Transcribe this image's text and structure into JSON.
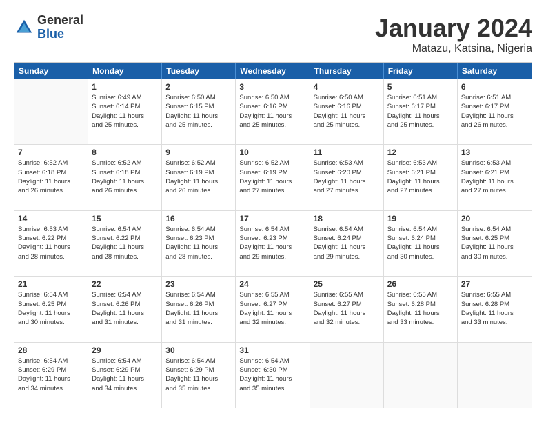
{
  "logo": {
    "general": "General",
    "blue": "Blue"
  },
  "title": "January 2024",
  "location": "Matazu, Katsina, Nigeria",
  "days": [
    "Sunday",
    "Monday",
    "Tuesday",
    "Wednesday",
    "Thursday",
    "Friday",
    "Saturday"
  ],
  "rows": [
    [
      {
        "day": "",
        "empty": true
      },
      {
        "day": "1",
        "sunrise": "Sunrise: 6:49 AM",
        "sunset": "Sunset: 6:14 PM",
        "daylight": "Daylight: 11 hours",
        "minutes": "and 25 minutes."
      },
      {
        "day": "2",
        "sunrise": "Sunrise: 6:50 AM",
        "sunset": "Sunset: 6:15 PM",
        "daylight": "Daylight: 11 hours",
        "minutes": "and 25 minutes."
      },
      {
        "day": "3",
        "sunrise": "Sunrise: 6:50 AM",
        "sunset": "Sunset: 6:16 PM",
        "daylight": "Daylight: 11 hours",
        "minutes": "and 25 minutes."
      },
      {
        "day": "4",
        "sunrise": "Sunrise: 6:50 AM",
        "sunset": "Sunset: 6:16 PM",
        "daylight": "Daylight: 11 hours",
        "minutes": "and 25 minutes."
      },
      {
        "day": "5",
        "sunrise": "Sunrise: 6:51 AM",
        "sunset": "Sunset: 6:17 PM",
        "daylight": "Daylight: 11 hours",
        "minutes": "and 25 minutes."
      },
      {
        "day": "6",
        "sunrise": "Sunrise: 6:51 AM",
        "sunset": "Sunset: 6:17 PM",
        "daylight": "Daylight: 11 hours",
        "minutes": "and 26 minutes."
      }
    ],
    [
      {
        "day": "7",
        "sunrise": "Sunrise: 6:52 AM",
        "sunset": "Sunset: 6:18 PM",
        "daylight": "Daylight: 11 hours",
        "minutes": "and 26 minutes."
      },
      {
        "day": "8",
        "sunrise": "Sunrise: 6:52 AM",
        "sunset": "Sunset: 6:18 PM",
        "daylight": "Daylight: 11 hours",
        "minutes": "and 26 minutes."
      },
      {
        "day": "9",
        "sunrise": "Sunrise: 6:52 AM",
        "sunset": "Sunset: 6:19 PM",
        "daylight": "Daylight: 11 hours",
        "minutes": "and 26 minutes."
      },
      {
        "day": "10",
        "sunrise": "Sunrise: 6:52 AM",
        "sunset": "Sunset: 6:19 PM",
        "daylight": "Daylight: 11 hours",
        "minutes": "and 27 minutes."
      },
      {
        "day": "11",
        "sunrise": "Sunrise: 6:53 AM",
        "sunset": "Sunset: 6:20 PM",
        "daylight": "Daylight: 11 hours",
        "minutes": "and 27 minutes."
      },
      {
        "day": "12",
        "sunrise": "Sunrise: 6:53 AM",
        "sunset": "Sunset: 6:21 PM",
        "daylight": "Daylight: 11 hours",
        "minutes": "and 27 minutes."
      },
      {
        "day": "13",
        "sunrise": "Sunrise: 6:53 AM",
        "sunset": "Sunset: 6:21 PM",
        "daylight": "Daylight: 11 hours",
        "minutes": "and 27 minutes."
      }
    ],
    [
      {
        "day": "14",
        "sunrise": "Sunrise: 6:53 AM",
        "sunset": "Sunset: 6:22 PM",
        "daylight": "Daylight: 11 hours",
        "minutes": "and 28 minutes."
      },
      {
        "day": "15",
        "sunrise": "Sunrise: 6:54 AM",
        "sunset": "Sunset: 6:22 PM",
        "daylight": "Daylight: 11 hours",
        "minutes": "and 28 minutes."
      },
      {
        "day": "16",
        "sunrise": "Sunrise: 6:54 AM",
        "sunset": "Sunset: 6:23 PM",
        "daylight": "Daylight: 11 hours",
        "minutes": "and 28 minutes."
      },
      {
        "day": "17",
        "sunrise": "Sunrise: 6:54 AM",
        "sunset": "Sunset: 6:23 PM",
        "daylight": "Daylight: 11 hours",
        "minutes": "and 29 minutes."
      },
      {
        "day": "18",
        "sunrise": "Sunrise: 6:54 AM",
        "sunset": "Sunset: 6:24 PM",
        "daylight": "Daylight: 11 hours",
        "minutes": "and 29 minutes."
      },
      {
        "day": "19",
        "sunrise": "Sunrise: 6:54 AM",
        "sunset": "Sunset: 6:24 PM",
        "daylight": "Daylight: 11 hours",
        "minutes": "and 30 minutes."
      },
      {
        "day": "20",
        "sunrise": "Sunrise: 6:54 AM",
        "sunset": "Sunset: 6:25 PM",
        "daylight": "Daylight: 11 hours",
        "minutes": "and 30 minutes."
      }
    ],
    [
      {
        "day": "21",
        "sunrise": "Sunrise: 6:54 AM",
        "sunset": "Sunset: 6:25 PM",
        "daylight": "Daylight: 11 hours",
        "minutes": "and 30 minutes."
      },
      {
        "day": "22",
        "sunrise": "Sunrise: 6:54 AM",
        "sunset": "Sunset: 6:26 PM",
        "daylight": "Daylight: 11 hours",
        "minutes": "and 31 minutes."
      },
      {
        "day": "23",
        "sunrise": "Sunrise: 6:54 AM",
        "sunset": "Sunset: 6:26 PM",
        "daylight": "Daylight: 11 hours",
        "minutes": "and 31 minutes."
      },
      {
        "day": "24",
        "sunrise": "Sunrise: 6:55 AM",
        "sunset": "Sunset: 6:27 PM",
        "daylight": "Daylight: 11 hours",
        "minutes": "and 32 minutes."
      },
      {
        "day": "25",
        "sunrise": "Sunrise: 6:55 AM",
        "sunset": "Sunset: 6:27 PM",
        "daylight": "Daylight: 11 hours",
        "minutes": "and 32 minutes."
      },
      {
        "day": "26",
        "sunrise": "Sunrise: 6:55 AM",
        "sunset": "Sunset: 6:28 PM",
        "daylight": "Daylight: 11 hours",
        "minutes": "and 33 minutes."
      },
      {
        "day": "27",
        "sunrise": "Sunrise: 6:55 AM",
        "sunset": "Sunset: 6:28 PM",
        "daylight": "Daylight: 11 hours",
        "minutes": "and 33 minutes."
      }
    ],
    [
      {
        "day": "28",
        "sunrise": "Sunrise: 6:54 AM",
        "sunset": "Sunset: 6:29 PM",
        "daylight": "Daylight: 11 hours",
        "minutes": "and 34 minutes."
      },
      {
        "day": "29",
        "sunrise": "Sunrise: 6:54 AM",
        "sunset": "Sunset: 6:29 PM",
        "daylight": "Daylight: 11 hours",
        "minutes": "and 34 minutes."
      },
      {
        "day": "30",
        "sunrise": "Sunrise: 6:54 AM",
        "sunset": "Sunset: 6:29 PM",
        "daylight": "Daylight: 11 hours",
        "minutes": "and 35 minutes."
      },
      {
        "day": "31",
        "sunrise": "Sunrise: 6:54 AM",
        "sunset": "Sunset: 6:30 PM",
        "daylight": "Daylight: 11 hours",
        "minutes": "and 35 minutes."
      },
      {
        "day": "",
        "empty": true
      },
      {
        "day": "",
        "empty": true
      },
      {
        "day": "",
        "empty": true
      }
    ]
  ]
}
